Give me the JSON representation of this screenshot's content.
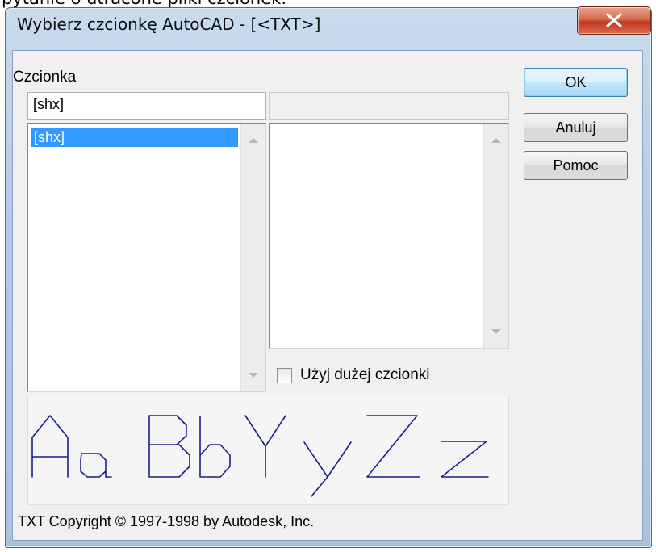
{
  "background": {
    "text": "pytanie o utracone pliki czcionek."
  },
  "window": {
    "title": "Wybierz czcionkę AutoCAD - [<TXT>]",
    "close_glyph": "X"
  },
  "font": {
    "label": "Czcionka",
    "input_value": "[shx]",
    "list_items": [
      "[shx]"
    ],
    "selected_index": 0
  },
  "style": {
    "input_value": "",
    "list_items": []
  },
  "options": {
    "big_font_label": "Użyj dużej czcionki",
    "big_font_checked": false
  },
  "buttons": {
    "ok": "OK",
    "cancel": "Anuluj",
    "help": "Pomoc"
  },
  "preview": {
    "sample_text": "AaBbYyZz"
  },
  "footer": {
    "copyright": "TXT  Copyright © 1997-1998 by Autodesk, Inc."
  },
  "colors": {
    "selection": "#3399ff",
    "preview_strokes": "#1b1f8a",
    "close_button": "#c9452a"
  },
  "icons": {
    "close": "close-x-icon",
    "scroll_up": "scroll-up-arrow-icon",
    "scroll_down": "scroll-down-arrow-icon"
  }
}
